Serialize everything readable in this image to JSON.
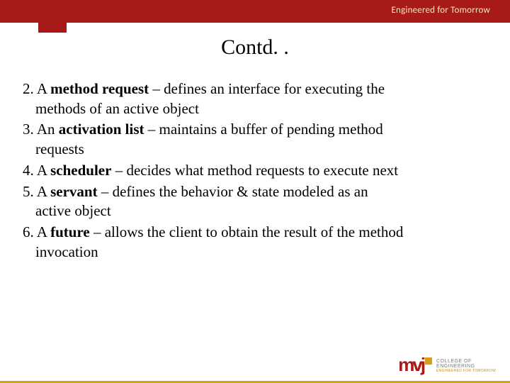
{
  "header": {
    "tagline": "Engineered for Tomorrow"
  },
  "title": "Contd. .",
  "items": [
    {
      "num": "2.",
      "pre": " A ",
      "bold": "method request",
      "post": " – defines an interface for  executing the",
      "cont": "methods of an active object"
    },
    {
      "num": "3.",
      "pre": " An ",
      "bold": "activation list",
      "post": " – maintains a buffer of pending method",
      "cont": "requests"
    },
    {
      "num": "4.",
      "pre": " A ",
      "bold": "scheduler",
      "post": " – decides what method requests  to execute next",
      "cont": ""
    },
    {
      "num": "5.",
      "pre": " A ",
      "bold": "servant",
      "post": " – defines the behavior & state  modeled as an",
      "cont": "active object"
    },
    {
      "num": "6.",
      "pre": " A ",
      "bold": "future",
      "post": " – allows the client to obtain the result  of the method",
      "cont": "invocation"
    }
  ],
  "logo": {
    "mark": "mvj",
    "line1": "COLLEGE OF",
    "line2": "ENGINEERING",
    "sub": "ENGINEERED FOR TOMORROW"
  }
}
